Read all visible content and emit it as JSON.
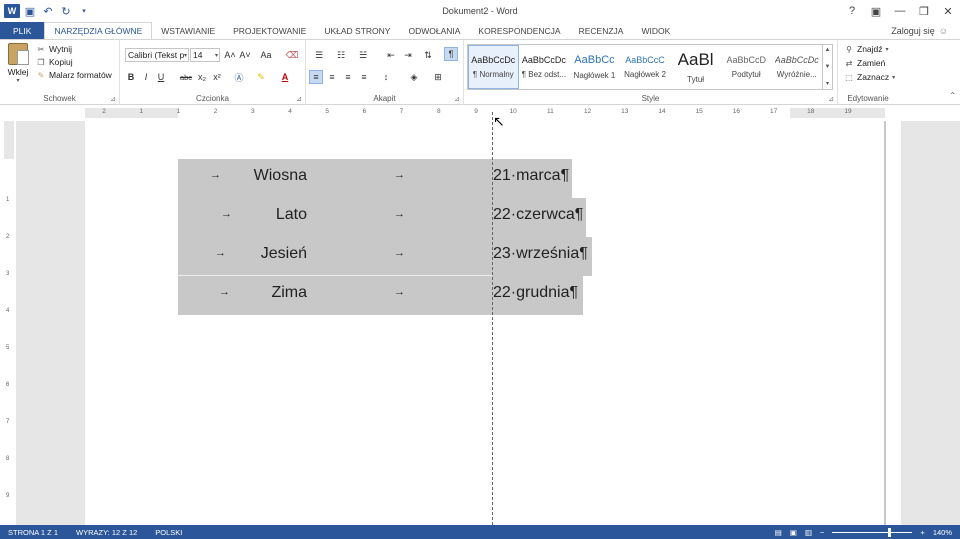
{
  "app": {
    "title": "Dokument2 - Word",
    "logo": "W",
    "user": "Zaloguj się"
  },
  "window_controls": {
    "help": "?",
    "ribbon_options": "▣",
    "minimize": "—",
    "restore": "❐",
    "close": "✕"
  },
  "tabs": [
    {
      "label": "PLIK"
    },
    {
      "label": "NARZĘDZIA GŁÓWNE"
    },
    {
      "label": "WSTAWIANIE"
    },
    {
      "label": "PROJEKTOWANIE"
    },
    {
      "label": "UKŁAD STRONY"
    },
    {
      "label": "ODWOŁANIA"
    },
    {
      "label": "KORESPONDENCJA"
    },
    {
      "label": "RECENZJA"
    },
    {
      "label": "WIDOK"
    }
  ],
  "ribbon": {
    "clipboard": {
      "label": "Schowek",
      "paste": "Wklej",
      "cut": "Wytnij",
      "copy": "Kopiuj",
      "format_painter": "Malarz formatów"
    },
    "font": {
      "label": "Czcionka",
      "font_name": "Calibri (Tekst p",
      "font_size": "14",
      "grow": "A˄",
      "shrink": "A˅",
      "case": "Aa",
      "bold": "B",
      "italic": "I",
      "underline": "U",
      "strike": "abc",
      "subscript": "x₂",
      "superscript": "x²"
    },
    "paragraph": {
      "label": "Akapit",
      "show_marks": "¶"
    },
    "styles": {
      "label": "Style",
      "items": [
        {
          "sample": "AaBbCcDc",
          "name": "¶ Normalny"
        },
        {
          "sample": "AaBbCcDc",
          "name": "¶ Bez odst..."
        },
        {
          "sample": "AaBbCc",
          "name": "Nagłówek 1"
        },
        {
          "sample": "AaBbCcC",
          "name": "Nagłówek 2"
        },
        {
          "sample": "AaBl",
          "name": "Tytuł"
        },
        {
          "sample": "AaBbCcD",
          "name": "Podtytuł"
        },
        {
          "sample": "AaBbCcDc",
          "name": "Wyróżnie..."
        }
      ]
    },
    "editing": {
      "label": "Edytowanie",
      "find": "Znajdź",
      "replace": "Zamień",
      "select": "Zaznacz"
    }
  },
  "ruler": {
    "h_numbers": [
      "2",
      "1",
      "1",
      "2",
      "3",
      "4",
      "5",
      "6",
      "7",
      "8",
      "9",
      "10",
      "11",
      "12",
      "13",
      "14",
      "15",
      "16",
      "17",
      "18",
      "19"
    ],
    "v_numbers": [
      "1",
      "2",
      "3",
      "4",
      "5",
      "6",
      "7",
      "8",
      "9"
    ]
  },
  "document": {
    "tab_mark": "→",
    "rows": [
      {
        "season": "Wiosna",
        "date": "21·marca¶"
      },
      {
        "season": "Lato",
        "date": "22·czerwca¶"
      },
      {
        "season": "Jesień",
        "date": "23·września¶"
      },
      {
        "season": "Zima",
        "date": "22·grudnia¶"
      }
    ]
  },
  "status": {
    "page": "STRONA 1 Z 1",
    "words": "WYRAZY: 12 Z 12",
    "language": "POLSKI",
    "zoom": "140%",
    "zoom_minus": "−",
    "zoom_plus": "+"
  }
}
